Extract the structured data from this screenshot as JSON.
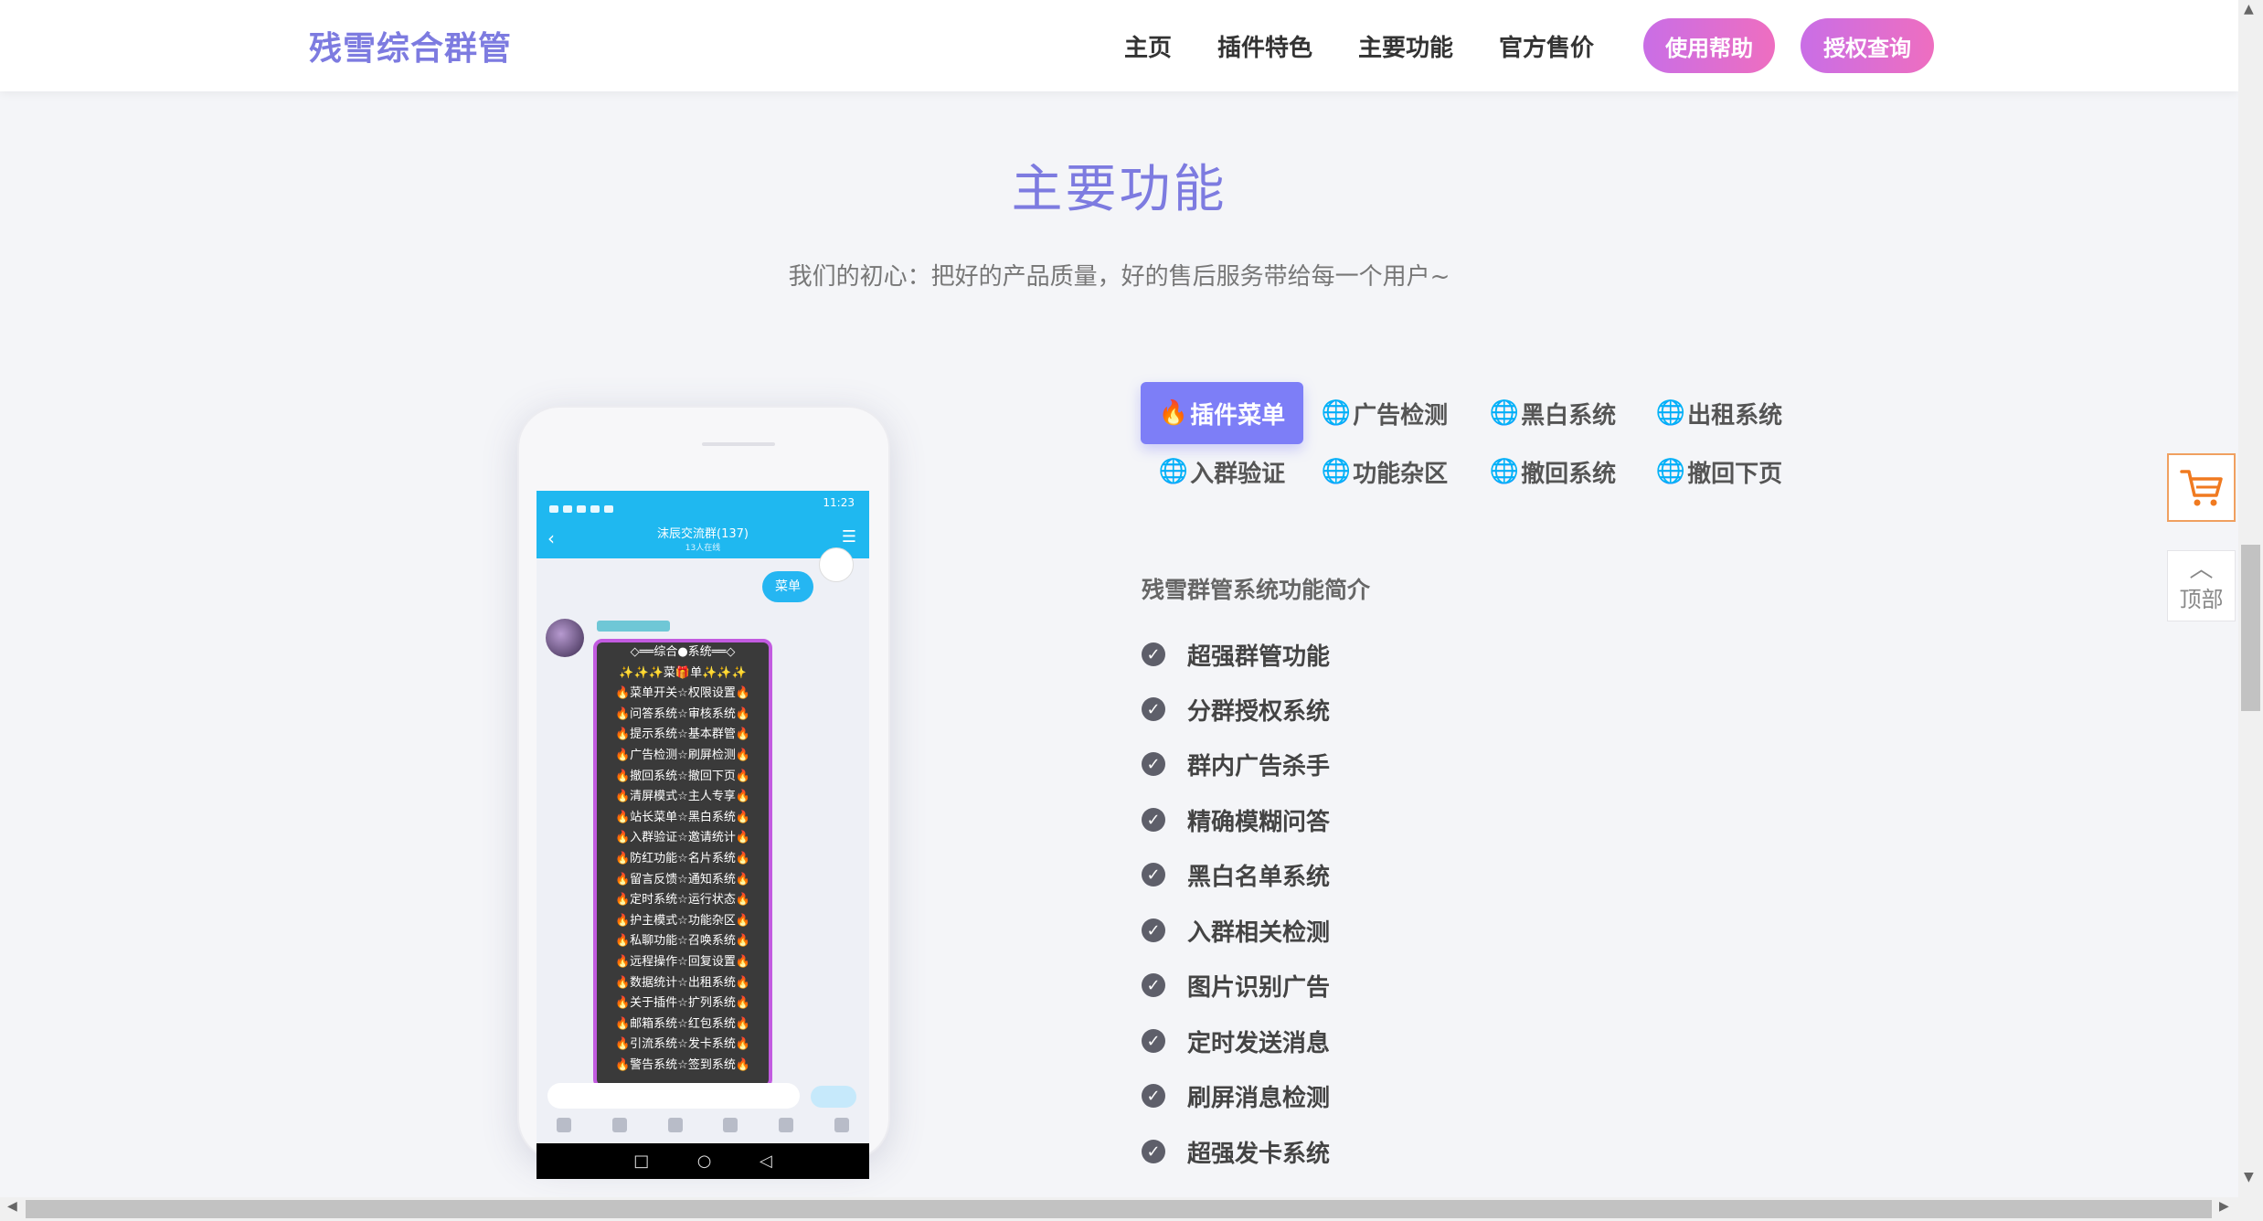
{
  "header": {
    "brand": "残雪综合群管",
    "nav": [
      "主页",
      "插件特色",
      "主要功能",
      "官方售价"
    ],
    "help_label": "使用帮助",
    "auth_label": "授权查询"
  },
  "section": {
    "title": "主要功能",
    "subtitle": "我们的初心：把好的产品质量，好的售后服务带给每一个用户~"
  },
  "phone": {
    "status_time": "11:23",
    "chat_title": "沫辰交流群(137)",
    "chat_subtitle": "13人在线",
    "bubble_label": "菜单",
    "menu_lines": [
      "◇══综合●系统══◇",
      "✨✨✨菜🎁单✨✨✨",
      "🔥菜单开关☆权限设置🔥",
      "🔥问答系统☆审核系统🔥",
      "🔥提示系统☆基本群管🔥",
      "🔥广告检测☆刷屏检测🔥",
      "🔥撤回系统☆撤回下页🔥",
      "🔥清屏模式☆主人专享🔥",
      "🔥站长菜单☆黑白系统🔥",
      "🔥入群验证☆邀请统计🔥",
      "🔥防红功能☆名片系统🔥",
      "🔥留言反馈☆通知系统🔥",
      "🔥定时系统☆运行状态🔥",
      "🔥护主模式☆功能杂区🔥",
      "🔥私聊功能☆召唤系统🔥",
      "🔥远程操作☆回复设置🔥",
      "🔥数据统计☆出租系统🔥",
      "🔥关于插件☆扩列系统🔥",
      "🔥邮箱系统☆红包系统🔥",
      "🔥引流系统☆发卡系统🔥",
      "🔥警告系统☆签到系统🔥"
    ]
  },
  "tabs": [
    {
      "icon": "fire-icon",
      "glyph": "🔥",
      "label": "插件菜单",
      "active": true
    },
    {
      "icon": "globe-icon",
      "glyph": "🌐",
      "label": "广告检测",
      "active": false
    },
    {
      "icon": "globe-icon",
      "glyph": "🌐",
      "label": "黑白系统",
      "active": false
    },
    {
      "icon": "globe-icon",
      "glyph": "🌐",
      "label": "出租系统",
      "active": false
    },
    {
      "icon": "globe-icon",
      "glyph": "🌐",
      "label": "入群验证",
      "active": false
    },
    {
      "icon": "globe-icon",
      "glyph": "🌐",
      "label": "功能杂区",
      "active": false
    },
    {
      "icon": "globe-icon",
      "glyph": "🌐",
      "label": "撤回系统",
      "active": false
    },
    {
      "icon": "globe-icon",
      "glyph": "🌐",
      "label": "撤回下页",
      "active": false
    }
  ],
  "intro": {
    "title": "残雪群管系统功能简介",
    "features": [
      "超强群管功能",
      "分群授权系统",
      "群内广告杀手",
      "精确模糊问答",
      "黑白名单系统",
      "入群相关检测",
      "图片识别广告",
      "定时发送消息",
      "刷屏消息检测",
      "超强发卡系统"
    ]
  },
  "floating": {
    "cart_icon": "cart-icon",
    "top_label": "顶部"
  },
  "colors": {
    "accent": "#7d7be0",
    "tab_active": "#7d7ef7",
    "pill_gradient_start": "#c96ee6",
    "pill_gradient_end": "#ee6ec0",
    "cart_orange": "#f07a20"
  }
}
